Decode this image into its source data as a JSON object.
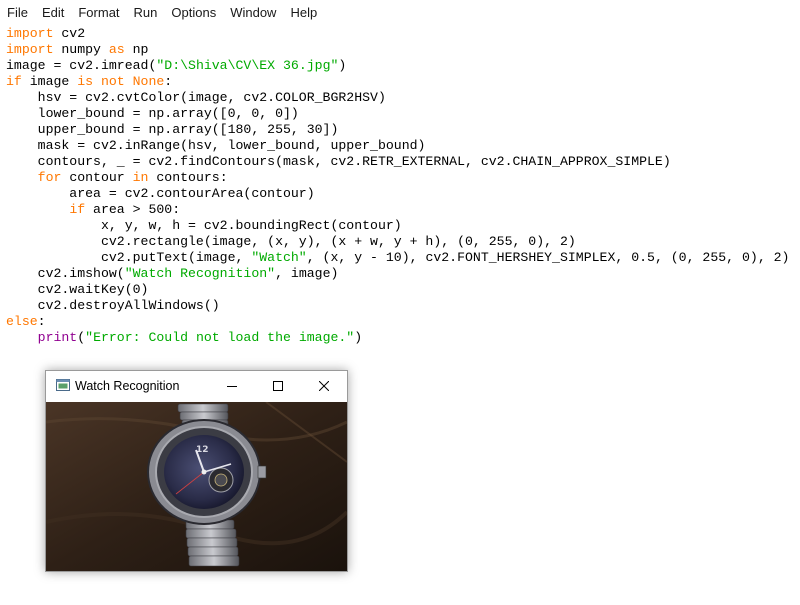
{
  "menu": [
    "File",
    "Edit",
    "Format",
    "Run",
    "Options",
    "Window",
    "Help"
  ],
  "code": [
    [
      [
        "kw",
        "import"
      ],
      [
        "t",
        " cv2"
      ]
    ],
    [
      [
        "kw",
        "import"
      ],
      [
        "t",
        " numpy "
      ],
      [
        "kw",
        "as"
      ],
      [
        "t",
        " np"
      ]
    ],
    [
      [
        "t",
        "image = cv2.imread("
      ],
      [
        "str",
        "\"D:\\Shiva\\CV\\EX 36.jpg\""
      ],
      [
        "t",
        ")"
      ]
    ],
    [
      [
        "kw",
        "if"
      ],
      [
        "t",
        " image "
      ],
      [
        "kw",
        "is not"
      ],
      [
        "t",
        " "
      ],
      [
        "kw",
        "None"
      ],
      [
        "t",
        ":"
      ]
    ],
    [
      [
        "t",
        "    hsv = cv2.cvtColor(image, cv2.COLOR_BGR2HSV)"
      ]
    ],
    [
      [
        "t",
        "    lower_bound = np.array([0, 0, 0])"
      ]
    ],
    [
      [
        "t",
        "    upper_bound = np.array([180, 255, 30])"
      ]
    ],
    [
      [
        "t",
        "    mask = cv2.inRange(hsv, lower_bound, upper_bound)"
      ]
    ],
    [
      [
        "t",
        "    contours, _ = cv2.findContours(mask, cv2.RETR_EXTERNAL, cv2.CHAIN_APPROX_SIMPLE)"
      ]
    ],
    [
      [
        "t",
        "    "
      ],
      [
        "kw",
        "for"
      ],
      [
        "t",
        " contour "
      ],
      [
        "kw",
        "in"
      ],
      [
        "t",
        " contours:"
      ]
    ],
    [
      [
        "t",
        "        area = cv2.contourArea(contour)"
      ]
    ],
    [
      [
        "t",
        "        "
      ],
      [
        "kw",
        "if"
      ],
      [
        "t",
        " area > 500:"
      ]
    ],
    [
      [
        "t",
        "            x, y, w, h = cv2.boundingRect(contour)"
      ]
    ],
    [
      [
        "t",
        "            cv2.rectangle(image, (x, y), (x + w, y + h), (0, 255, 0), 2)"
      ]
    ],
    [
      [
        "t",
        "            cv2.putText(image, "
      ],
      [
        "str",
        "\"Watch\""
      ],
      [
        "t",
        ", (x, y - 10), cv2.FONT_HERSHEY_SIMPLEX, 0.5, (0, 255, 0), 2)"
      ]
    ],
    [
      [
        "t",
        "    cv2.imshow("
      ],
      [
        "str",
        "\"Watch Recognition\""
      ],
      [
        "t",
        ", image)"
      ]
    ],
    [
      [
        "t",
        "    cv2.waitKey(0)"
      ]
    ],
    [
      [
        "t",
        "    cv2.destroyAllWindows()"
      ]
    ],
    [
      [
        "kw",
        "else"
      ],
      [
        "t",
        ":"
      ]
    ],
    [
      [
        "t",
        "    "
      ],
      [
        "bi",
        "print"
      ],
      [
        "t",
        "("
      ],
      [
        "str",
        "\"Error: Could not load the image.\""
      ],
      [
        "t",
        ")"
      ]
    ]
  ],
  "cv_window": {
    "title": "Watch Recognition",
    "buttons": [
      "minimize",
      "maximize",
      "close"
    ],
    "image_description_icon": "watch-photo"
  },
  "colors": {
    "keyword": "#ff7700",
    "string": "#00aa00",
    "builtin": "#900090"
  }
}
